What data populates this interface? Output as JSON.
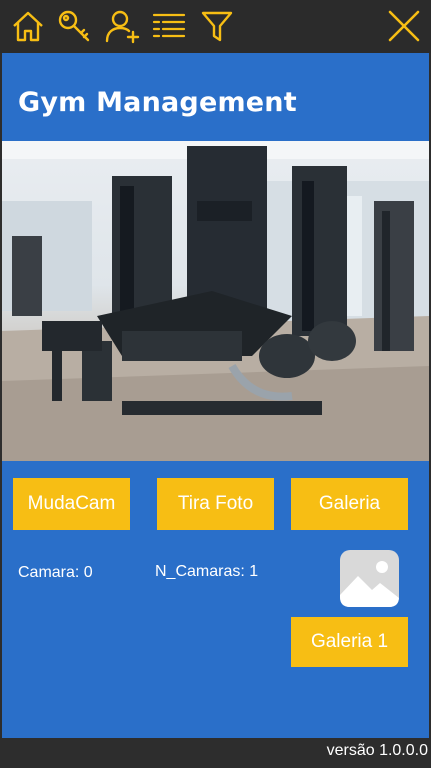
{
  "toolbar": {
    "icons": [
      "home-icon",
      "key-icon",
      "add-user-icon",
      "list-icon",
      "filter-icon",
      "close-icon"
    ],
    "accent_color": "#f7be14",
    "background_color": "#2b2b2b"
  },
  "main": {
    "title": "Gym Management",
    "background_color": "#2a6fc9",
    "hero_image": "gym-equipment-photo",
    "buttons": {
      "muda_cam": "MudaCam",
      "tira_foto": "Tira Foto",
      "galeria": "Galeria",
      "galeria_1": "Galeria 1"
    },
    "button_color": "#f7be14",
    "status": {
      "camara": "Camara: 0",
      "n_camaras": "N_Camaras: 1"
    },
    "thumbnail_icon": "image-placeholder-icon"
  },
  "footer": {
    "version": "versão 1.0.0.0"
  }
}
